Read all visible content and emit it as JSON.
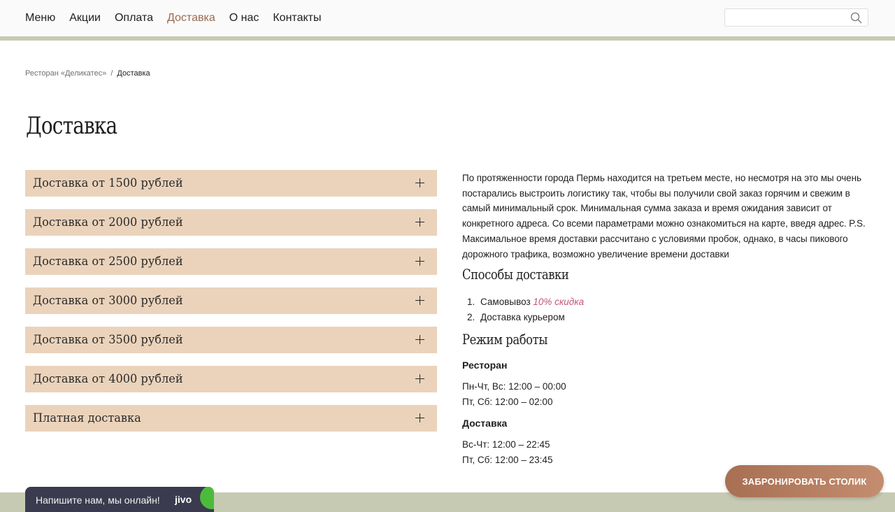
{
  "nav": {
    "items": [
      {
        "label": "Меню"
      },
      {
        "label": "Акции"
      },
      {
        "label": "Оплата"
      },
      {
        "label": "Доставка",
        "active": true
      },
      {
        "label": "О нас"
      },
      {
        "label": "Контакты"
      }
    ],
    "active_color": "#9a6a4e"
  },
  "search": {
    "value": "",
    "placeholder": "",
    "icon": "search-icon"
  },
  "breadcrumb": {
    "root": "Ресторан «Деликатес»",
    "separator": "/",
    "current": "Доставка"
  },
  "page": {
    "title": "Доставка"
  },
  "accordion": {
    "items": [
      {
        "label": "Доставка от 1500 рублей"
      },
      {
        "label": "Доставка от 2000 рублей"
      },
      {
        "label": "Доставка от 2500 рублей"
      },
      {
        "label": "Доставка от 3000 рублей"
      },
      {
        "label": "Доставка от 3500 рублей"
      },
      {
        "label": "Доставка от 4000 рублей"
      },
      {
        "label": "Платная доставка"
      }
    ],
    "icon": "plus-icon",
    "item_color": "#ebd3bb"
  },
  "content": {
    "intro": "По протяженности города Пермь находится на третьем месте, но несмотря на это мы очень постарались выстроить логистику так, чтобы вы получили свой заказ горячим и свежим в самый минимальный срок. Минимальная сумма заказа и время ожидания зависит от конкретного адреса. Со всеми параметрами можно ознакомиться на карте, введя адрес. P.S. Максимальное время доставки рассчитано с условиями пробок, однако, в часы пикового дорожного трафика, возможно увеличение времени доставки",
    "methods_title": "Способы доставки",
    "methods": [
      {
        "num": "1.",
        "label": "Самовывоз",
        "note": "10% скидка"
      },
      {
        "num": "2.",
        "label": "Доставка курьером"
      }
    ],
    "hours_title": "Режим работы",
    "restaurant": {
      "title": "Ресторан",
      "lines": [
        "Пн-Чт, Вс: 12:00 – 00:00",
        "Пт, Сб: 12:00 – 02:00"
      ]
    },
    "delivery": {
      "title": "Доставка",
      "lines": [
        "Вс-Чт: 12:00 – 22:45",
        "Пт, Сб: 12:00 – 23:45"
      ]
    },
    "discount_color": "#c2547e"
  },
  "chat": {
    "text": "Напишите нам, мы онлайн!",
    "logo": "jivo"
  },
  "book_button": {
    "label": "ЗАБРОНИРОВАТЬ СТОЛИК"
  }
}
